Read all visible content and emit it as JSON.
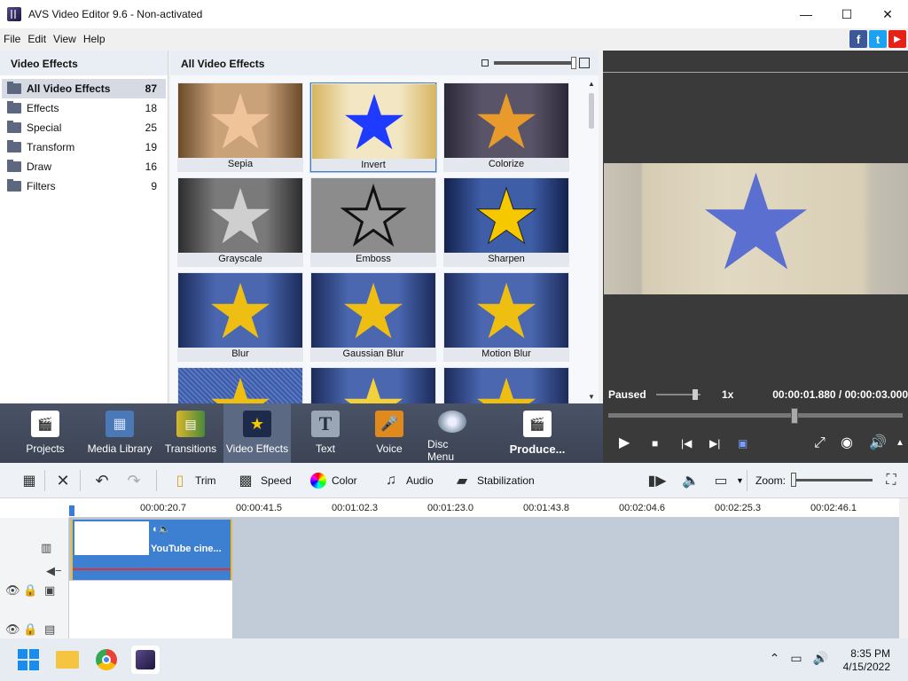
{
  "window": {
    "title": "AVS Video Editor 9.6 - Non-activated",
    "controls": {
      "minimize": "—",
      "maximize": "☐",
      "close": "✕"
    }
  },
  "menu": [
    "File",
    "Edit",
    "View",
    "Help"
  ],
  "social": [
    {
      "name": "facebook-icon",
      "glyph": "f",
      "color": "#3b5998"
    },
    {
      "name": "twitter-icon",
      "glyph": "t",
      "color": "#1da1f2"
    },
    {
      "name": "youtube-icon",
      "glyph": "▶",
      "color": "#e62117"
    }
  ],
  "left_panel": {
    "title": "Video Effects",
    "categories": [
      {
        "label": "All Video Effects",
        "count": "87",
        "active": true
      },
      {
        "label": "Effects",
        "count": "18"
      },
      {
        "label": "Special",
        "count": "25"
      },
      {
        "label": "Transform",
        "count": "19"
      },
      {
        "label": "Draw",
        "count": "16"
      },
      {
        "label": "Filters",
        "count": "9"
      }
    ]
  },
  "center_panel": {
    "title": "All Video Effects",
    "effects": [
      "Sepia",
      "Invert",
      "Colorize",
      "Grayscale",
      "Emboss",
      "Sharpen",
      "Blur",
      "Gaussian Blur",
      "Motion Blur",
      "",
      "",
      ""
    ],
    "selected": "Invert"
  },
  "playback": {
    "status": "Paused",
    "speed": "1x",
    "time": "00:00:01.880  /  00:00:03.000",
    "seek_fraction": 0.63
  },
  "main_toolbar": [
    {
      "label": "Projects",
      "icon": "clapper-icon"
    },
    {
      "label": "Media Library",
      "icon": "film-icon"
    },
    {
      "label": "Transitions",
      "icon": "transitions-icon"
    },
    {
      "label": "Video Effects",
      "icon": "star-icon",
      "active": true
    },
    {
      "label": "Text",
      "icon": "text-icon"
    },
    {
      "label": "Voice",
      "icon": "microphone-icon"
    },
    {
      "label": "Disc Menu",
      "icon": "disc-icon"
    },
    {
      "label": "Produce...",
      "icon": "produce-icon"
    }
  ],
  "edit_toolbar": {
    "trim": "Trim",
    "speed": "Speed",
    "color": "Color",
    "audio": "Audio",
    "stabilization": "Stabilization",
    "zoom": "Zoom:"
  },
  "timeline": {
    "ticks": [
      "00:00:20.7",
      "00:00:41.5",
      "00:01:02.3",
      "00:01:23.0",
      "00:01:43.8",
      "00:02:04.6",
      "00:02:25.3",
      "00:02:46.1"
    ],
    "clip_label": "YouTube cine..."
  },
  "taskbar": {
    "time": "8:35 PM",
    "date": "4/15/2022"
  }
}
